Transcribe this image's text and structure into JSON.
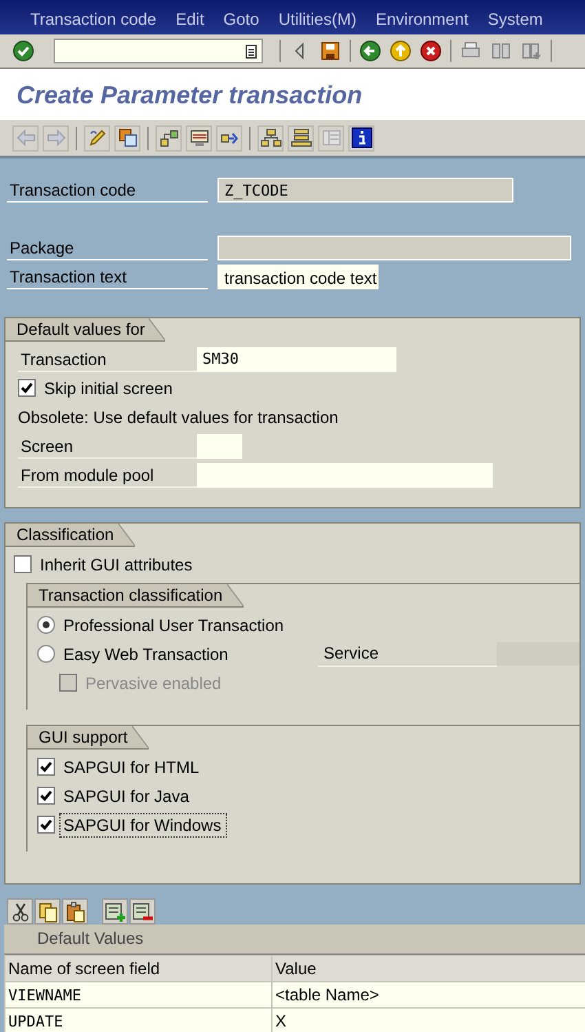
{
  "menu_bar": {
    "items": [
      "Transaction code",
      "Edit",
      "Goto",
      "Utilities(M)",
      "Environment",
      "System"
    ]
  },
  "title": "Create Parameter transaction",
  "header_fields": [
    {
      "label": "Transaction code",
      "value": "Z_TCODE",
      "kind": "display"
    },
    {
      "label": "Package",
      "kind": "display"
    },
    {
      "label": "Transaction text",
      "value": "transaction code text",
      "kind": "input"
    }
  ],
  "default_values": {
    "title": "Default values for",
    "items": [
      {
        "kind": "field",
        "label": "Transaction",
        "value": "SM30"
      },
      {
        "kind": "checkbox",
        "label": "Skip initial screen",
        "checked": true,
        "disabled": false,
        "focused": false
      },
      {
        "kind": "text",
        "text": "Obsolete: Use default values for transaction"
      },
      {
        "kind": "field",
        "label": "Screen"
      },
      {
        "kind": "field",
        "label": "From module pool"
      }
    ]
  },
  "classification": {
    "title": "Classification",
    "items": [
      {
        "kind": "checkbox",
        "label": "Inherit GUI attributes",
        "checked": false,
        "disabled": false,
        "focused": false
      },
      {
        "kind": "group",
        "title": "Transaction classification",
        "items": [
          {
            "kind": "radio",
            "label": "Professional User Transaction",
            "selected": true,
            "disabled": false
          },
          {
            "kind": "radio",
            "label": "Easy Web Transaction",
            "selected": false,
            "disabled": false,
            "service": {
              "label": "Service",
              "disabled": true
            },
            "children": [
              {
                "kind": "checkbox",
                "label": "Pervasive enabled",
                "checked": false,
                "disabled": true,
                "focused": false
              }
            ]
          }
        ]
      },
      {
        "kind": "group",
        "title": "GUI support",
        "items": [
          {
            "kind": "checkbox",
            "label": "SAPGUI for HTML",
            "checked": true,
            "disabled": false,
            "focused": false
          },
          {
            "kind": "checkbox",
            "label": "SAPGUI for Java",
            "checked": true,
            "disabled": false,
            "focused": false
          },
          {
            "kind": "checkbox",
            "label": "SAPGUI for Windows",
            "checked": true,
            "disabled": false,
            "focused": true
          }
        ]
      }
    ]
  },
  "default_values_table": {
    "title": "Default Values",
    "columns": [
      "Name of screen field",
      "Value"
    ],
    "rows": [
      [
        "VIEWNAME",
        "<table Name>"
      ],
      [
        "UPDATE",
        "X"
      ]
    ]
  }
}
